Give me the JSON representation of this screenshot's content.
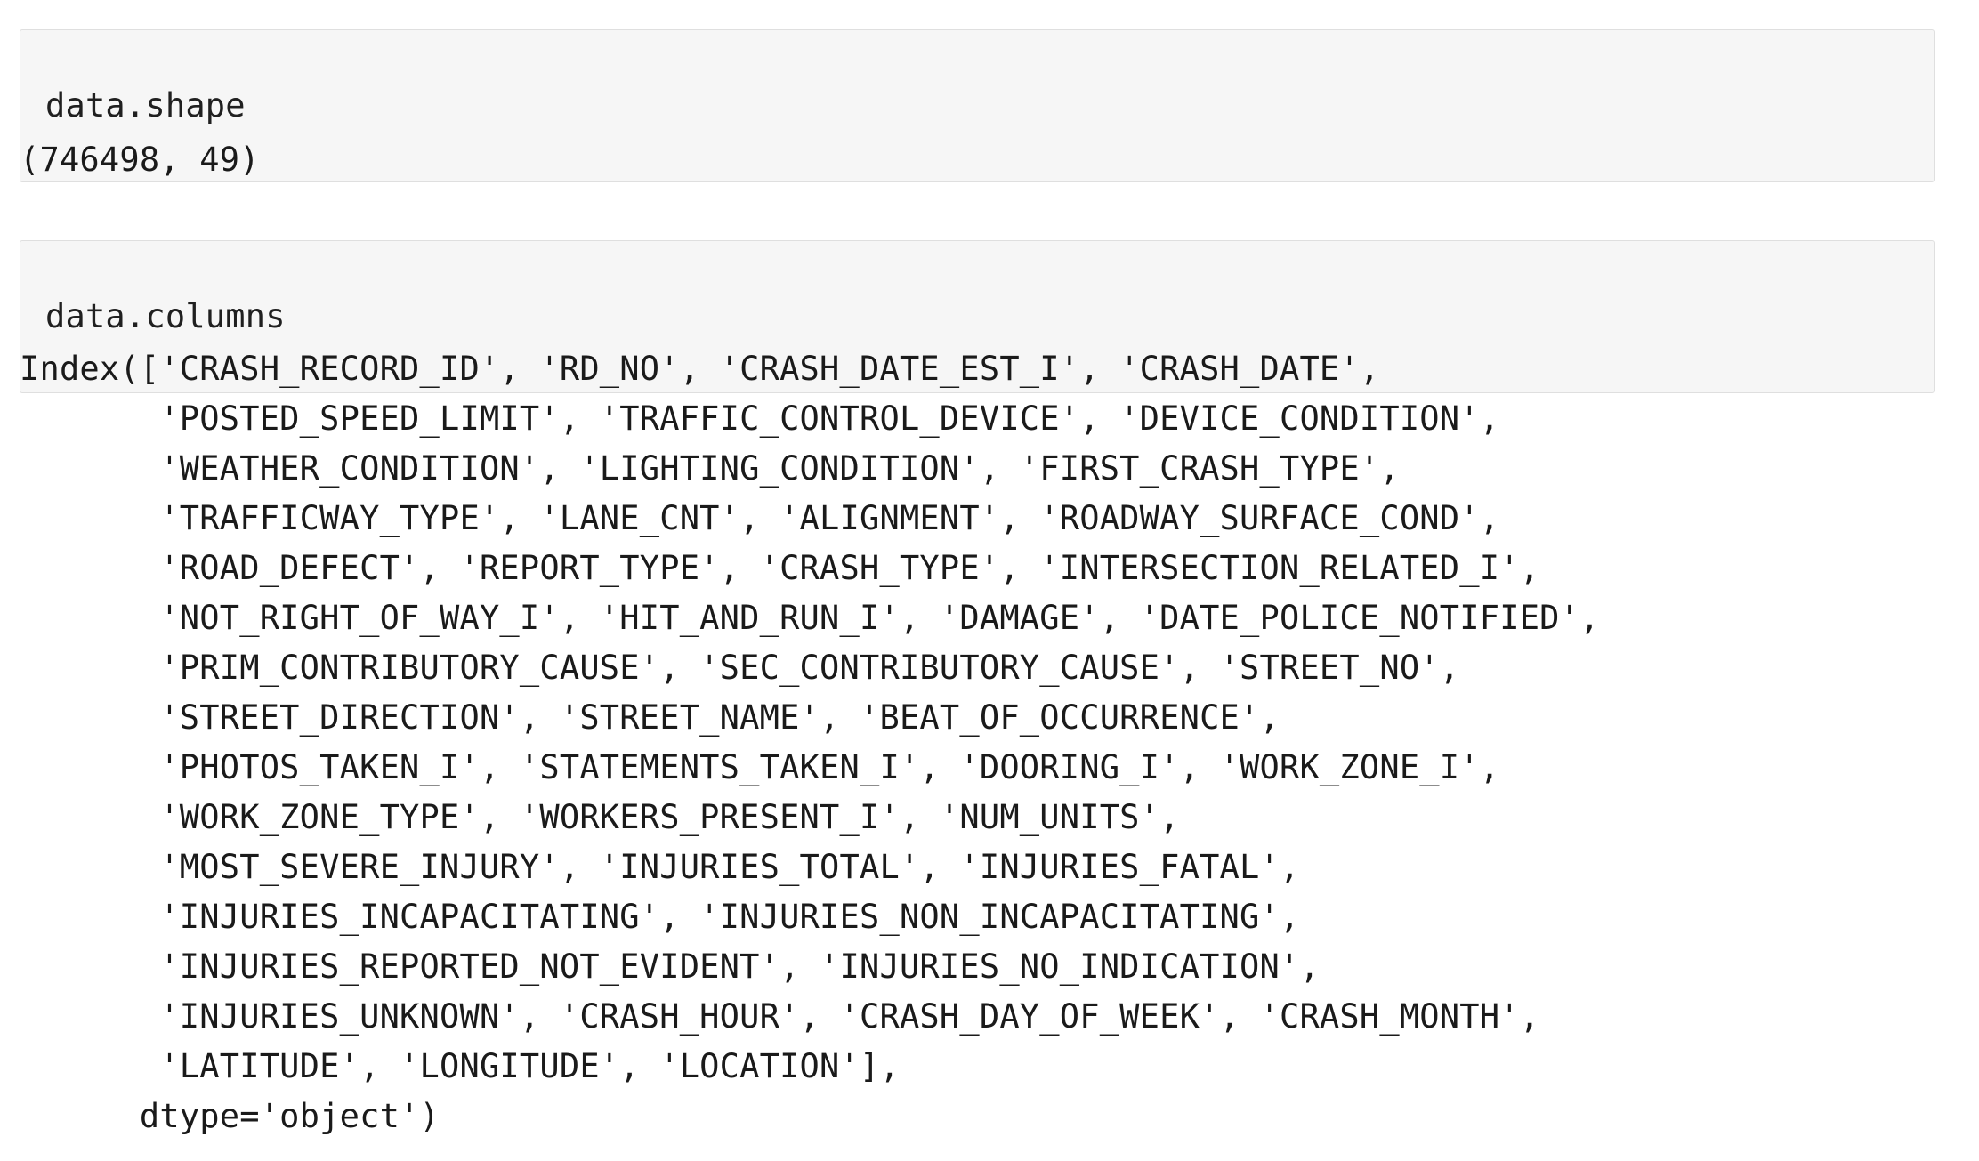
{
  "notebook": {
    "cells": [
      {
        "type": "code",
        "name": "data-shape",
        "source": "data.shape",
        "output": "(746498, 49)"
      },
      {
        "type": "code",
        "name": "data-columns",
        "source": "data.columns",
        "output": "Index(['CRASH_RECORD_ID', 'RD_NO', 'CRASH_DATE_EST_I', 'CRASH_DATE',\n       'POSTED_SPEED_LIMIT', 'TRAFFIC_CONTROL_DEVICE', 'DEVICE_CONDITION',\n       'WEATHER_CONDITION', 'LIGHTING_CONDITION', 'FIRST_CRASH_TYPE',\n       'TRAFFICWAY_TYPE', 'LANE_CNT', 'ALIGNMENT', 'ROADWAY_SURFACE_COND',\n       'ROAD_DEFECT', 'REPORT_TYPE', 'CRASH_TYPE', 'INTERSECTION_RELATED_I',\n       'NOT_RIGHT_OF_WAY_I', 'HIT_AND_RUN_I', 'DAMAGE', 'DATE_POLICE_NOTIFIED',\n       'PRIM_CONTRIBUTORY_CAUSE', 'SEC_CONTRIBUTORY_CAUSE', 'STREET_NO',\n       'STREET_DIRECTION', 'STREET_NAME', 'BEAT_OF_OCCURRENCE',\n       'PHOTOS_TAKEN_I', 'STATEMENTS_TAKEN_I', 'DOORING_I', 'WORK_ZONE_I',\n       'WORK_ZONE_TYPE', 'WORKERS_PRESENT_I', 'NUM_UNITS',\n       'MOST_SEVERE_INJURY', 'INJURIES_TOTAL', 'INJURIES_FATAL',\n       'INJURIES_INCAPACITATING', 'INJURIES_NON_INCAPACITATING',\n       'INJURIES_REPORTED_NOT_EVIDENT', 'INJURIES_NO_INDICATION',\n       'INJURIES_UNKNOWN', 'CRASH_HOUR', 'CRASH_DAY_OF_WEEK', 'CRASH_MONTH',\n       'LATITUDE', 'LONGITUDE', 'LOCATION'],\n      dtype='object')",
        "dataframe_shape": {
          "rows": 746498,
          "columns": 49
        },
        "column_names": [
          "CRASH_RECORD_ID",
          "RD_NO",
          "CRASH_DATE_EST_I",
          "CRASH_DATE",
          "POSTED_SPEED_LIMIT",
          "TRAFFIC_CONTROL_DEVICE",
          "DEVICE_CONDITION",
          "WEATHER_CONDITION",
          "LIGHTING_CONDITION",
          "FIRST_CRASH_TYPE",
          "TRAFFICWAY_TYPE",
          "LANE_CNT",
          "ALIGNMENT",
          "ROADWAY_SURFACE_COND",
          "ROAD_DEFECT",
          "REPORT_TYPE",
          "CRASH_TYPE",
          "INTERSECTION_RELATED_I",
          "NOT_RIGHT_OF_WAY_I",
          "HIT_AND_RUN_I",
          "DAMAGE",
          "DATE_POLICE_NOTIFIED",
          "PRIM_CONTRIBUTORY_CAUSE",
          "SEC_CONTRIBUTORY_CAUSE",
          "STREET_NO",
          "STREET_DIRECTION",
          "STREET_NAME",
          "BEAT_OF_OCCURRENCE",
          "PHOTOS_TAKEN_I",
          "STATEMENTS_TAKEN_I",
          "DOORING_I",
          "WORK_ZONE_I",
          "WORK_ZONE_TYPE",
          "WORKERS_PRESENT_I",
          "NUM_UNITS",
          "MOST_SEVERE_INJURY",
          "INJURIES_TOTAL",
          "INJURIES_FATAL",
          "INJURIES_INCAPACITATING",
          "INJURIES_NON_INCAPACITATING",
          "INJURIES_REPORTED_NOT_EVIDENT",
          "INJURIES_NO_INDICATION",
          "INJURIES_UNKNOWN",
          "CRASH_HOUR",
          "CRASH_DAY_OF_WEEK",
          "CRASH_MONTH",
          "LATITUDE",
          "LONGITUDE",
          "LOCATION"
        ],
        "dtype": "object"
      }
    ]
  },
  "colors": {
    "input_cell_background": "#f6f6f6",
    "input_cell_border": "#dfdfdf",
    "page_background": "#ffffff",
    "text": "#1a1a1a"
  }
}
